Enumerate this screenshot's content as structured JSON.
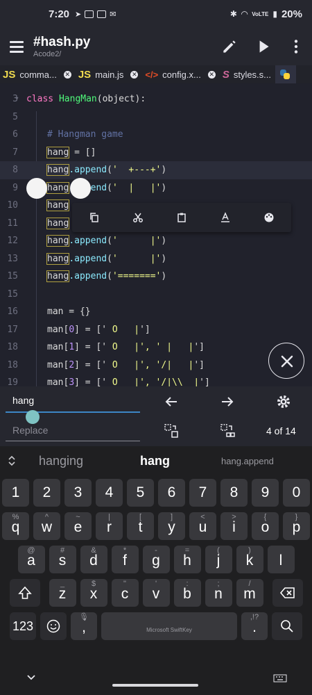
{
  "status": {
    "time": "7:20",
    "network_label": "VoLTE",
    "battery": "20%"
  },
  "appbar": {
    "title": "#hash.py",
    "subtitle": "Acode2/"
  },
  "tabs": [
    {
      "icon": "JS",
      "label": "comma..."
    },
    {
      "icon": "JS",
      "label": "main.js"
    },
    {
      "icon": "</>",
      "label": "config.x..."
    },
    {
      "icon": "S",
      "label": "styles.s..."
    }
  ],
  "editor": {
    "line_numbers": [
      "3",
      "5",
      "6",
      "7",
      "8",
      "9",
      "10",
      "11",
      "12",
      "13",
      "15",
      "16",
      "17",
      "18",
      "19"
    ],
    "lines": {
      "l3": {
        "kw": "class",
        "name": "HangMan",
        "rest": "(object):"
      },
      "l5": "# Hangman game",
      "l6": {
        "var": "hang",
        "rest": " = []"
      },
      "l7": {
        "var": "hang",
        "method": ".append",
        "open": "(",
        "str": "'  +---+'",
        "close": ")"
      },
      "l8": {
        "var": "hang",
        "method": ".append",
        "open": "(",
        "str": "'  |   |'",
        "close": ")"
      },
      "l9": {
        "var": "hang"
      },
      "l10": {
        "var": "hang"
      },
      "l11": {
        "var": "hang",
        "method": ".append",
        "open": "(",
        "str": "'      |'",
        "close": ")"
      },
      "l12": {
        "var": "hang",
        "method": ".append",
        "open": "(",
        "str": "'      |'",
        "close": ")"
      },
      "l13": {
        "var": "hang",
        "method": ".append",
        "open": "(",
        "str": "'======='",
        "close": ")"
      },
      "l16": {
        "code": "man = {}"
      },
      "l17": {
        "a": "man[",
        "n": "0",
        "b": "] = ['",
        "s": " O   |",
        "c": "']"
      },
      "l18": {
        "a": "man[",
        "n": "1",
        "b": "] = ['",
        "s": " O   |', ' |   |",
        "c": "']"
      },
      "l19": {
        "a": "man[",
        "n": "2",
        "b": "] = ['",
        "s": " O   |', '/|   |",
        "c": "']"
      },
      "l20": {
        "a": "man[",
        "n": "3",
        "b": "] = ['",
        "s": " O   |', '/|\\\\  |",
        "c": "']"
      }
    }
  },
  "search": {
    "find_value": "hang",
    "replace_placeholder": "Replace",
    "count": "4 of 14"
  },
  "keyboard": {
    "suggestions": [
      "hanging",
      "hang",
      "hang.append"
    ],
    "numbers": [
      "1",
      "2",
      "3",
      "4",
      "5",
      "6",
      "7",
      "8",
      "9",
      "0"
    ],
    "row1": [
      [
        "q",
        "%"
      ],
      [
        "w",
        "^"
      ],
      [
        "e",
        "~"
      ],
      [
        "r",
        "|"
      ],
      [
        "t",
        "["
      ],
      [
        "y",
        "]"
      ],
      [
        "u",
        "<"
      ],
      [
        "i",
        ">"
      ],
      [
        "o",
        "{"
      ],
      [
        "p",
        "}"
      ]
    ],
    "row2": [
      [
        "a",
        "@"
      ],
      [
        "s",
        "#"
      ],
      [
        "d",
        "&"
      ],
      [
        "f",
        "*"
      ],
      [
        "g",
        "-"
      ],
      [
        "h",
        "="
      ],
      [
        "j",
        "("
      ],
      [
        "k",
        ")"
      ],
      [
        "l",
        ""
      ]
    ],
    "row3": [
      [
        "z",
        "_"
      ],
      [
        "x",
        "$"
      ],
      [
        "c",
        "\""
      ],
      [
        "v",
        "'"
      ],
      [
        "b",
        ":"
      ],
      [
        "n",
        ";"
      ],
      [
        "m",
        "/"
      ]
    ],
    "bottom": {
      "num_label": "123",
      "comma": ",",
      "space_label": "Microsoft SwiftKey",
      "period": ".",
      "period_alt": ",!?"
    }
  },
  "colors": {
    "accent": "#3d86c6",
    "highlight_border": "#b0a040"
  }
}
